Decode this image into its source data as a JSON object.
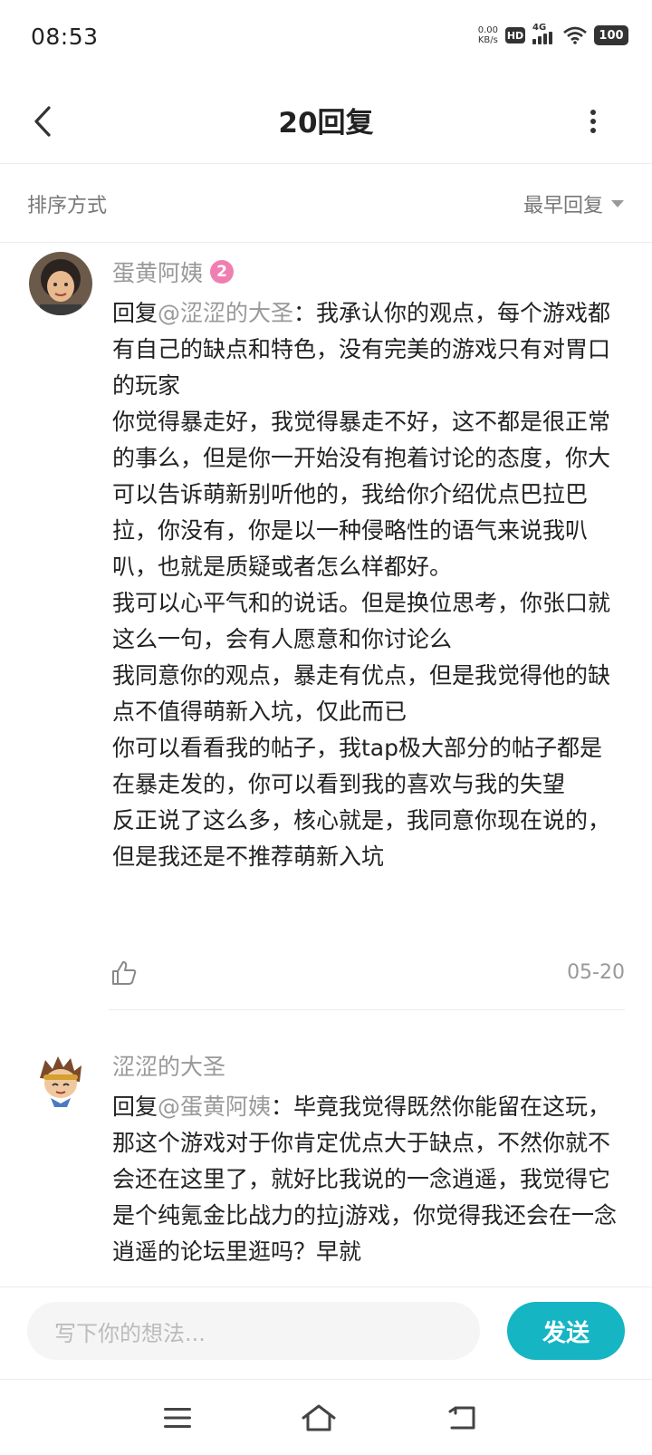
{
  "status_bar": {
    "time": "08:53",
    "net_speed_value": "0.00",
    "net_speed_unit": "KB/s",
    "hd_badge": "HD",
    "signal_label": "4G",
    "battery": "100"
  },
  "nav": {
    "title": "20回复",
    "back_icon": "chevron-left-icon",
    "more_icon": "more-vertical-icon"
  },
  "sort": {
    "label": "排序方式",
    "value": "最早回复"
  },
  "comments": [
    {
      "author": "蛋黄阿姨",
      "level": "2",
      "reply_prefix": "回复",
      "mention": "@涩涩的大圣",
      "first_line": "：我承认你的观点，每个游戏都有自己的缺点和特色，没有完美的游戏只有对胃口的玩家",
      "paragraphs": [
        "你觉得暴走好，我觉得暴走不好，这不都是很正常的事么，但是你一开始没有抱着讨论的态度，你大可以告诉萌新别听他的，我给你介绍优点巴拉巴拉，你没有，你是以一种侵略性的语气来说我叭叭，也就是质疑或者怎么样都好。",
        "我可以心平气和的说话。但是换位思考，你张口就这么一句，会有人愿意和你讨论么",
        "我同意你的观点，暴走有优点，但是我觉得他的缺点不值得萌新入坑，仅此而已",
        "你可以看看我的帖子，我tap极大部分的帖子都是在暴走发的，你可以看到我的喜欢与我的失望",
        "反正说了这么多，核心就是，我同意你现在说的，但是我还是不推荐萌新入坑"
      ],
      "date": "05-20"
    },
    {
      "author": "涩涩的大圣",
      "reply_prefix": "回复",
      "mention": "@蛋黄阿姨",
      "first_line": "：毕竟我觉得既然你能留在这玩，那这个游戏对于你肯定优点大于缺点，不然你就不会还在这里了，就好比我说的一念逍遥，我觉得它是个纯氪金比战力的拉j游戏，你觉得我还会在一念逍遥的论坛里逛吗？早就"
    }
  ],
  "composer": {
    "placeholder": "写下你的想法...",
    "send_label": "发送"
  },
  "colors": {
    "accent": "#15b5c4",
    "muted": "#999999",
    "level_badge": "#f07fb1"
  }
}
